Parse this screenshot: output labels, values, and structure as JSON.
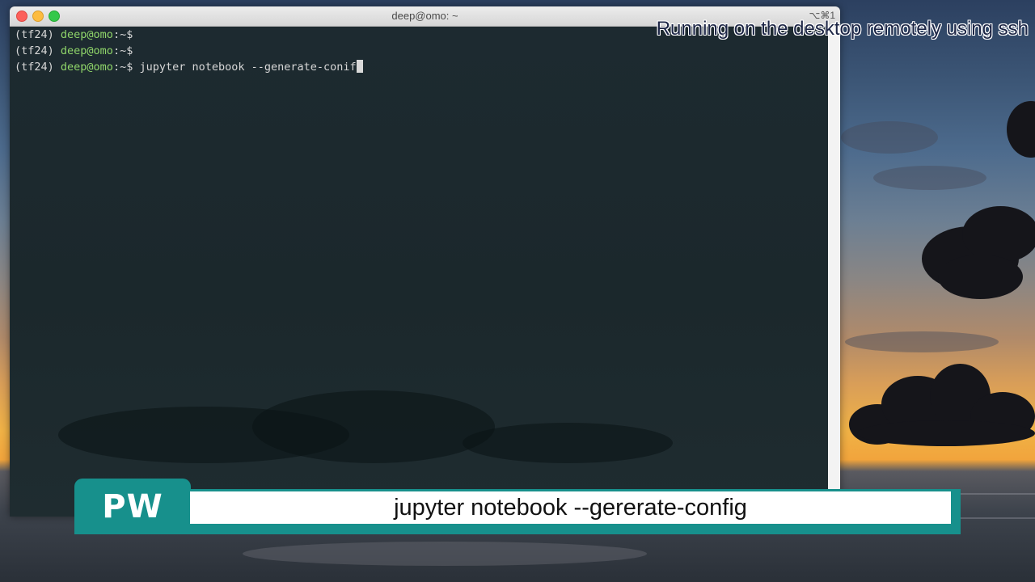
{
  "window": {
    "title": "deep@omo: ~",
    "shortcut": "⌥⌘1"
  },
  "terminal": {
    "lines": [
      {
        "env": "(tf24) ",
        "user": "deep@omo",
        "prompt": ":~$",
        "command": ""
      },
      {
        "env": "(tf24) ",
        "user": "deep@omo",
        "prompt": ":~$",
        "command": ""
      },
      {
        "env": "(tf24) ",
        "user": "deep@omo",
        "prompt": ":~$",
        "command": " jupyter notebook --generate-conif"
      }
    ]
  },
  "overlay": {
    "caption": "Running on the desktop remotely using ssh",
    "badge": "PW",
    "subtitle": "jupyter notebook --gererate-config"
  },
  "colors": {
    "user_green": "#90d66a",
    "terminal_bg": "#1b272b",
    "accent_teal": "#17908c"
  },
  "icons": {
    "close": "close-traffic-light-icon",
    "minimize": "minimize-traffic-light-icon",
    "maximize": "maximize-traffic-light-icon"
  }
}
